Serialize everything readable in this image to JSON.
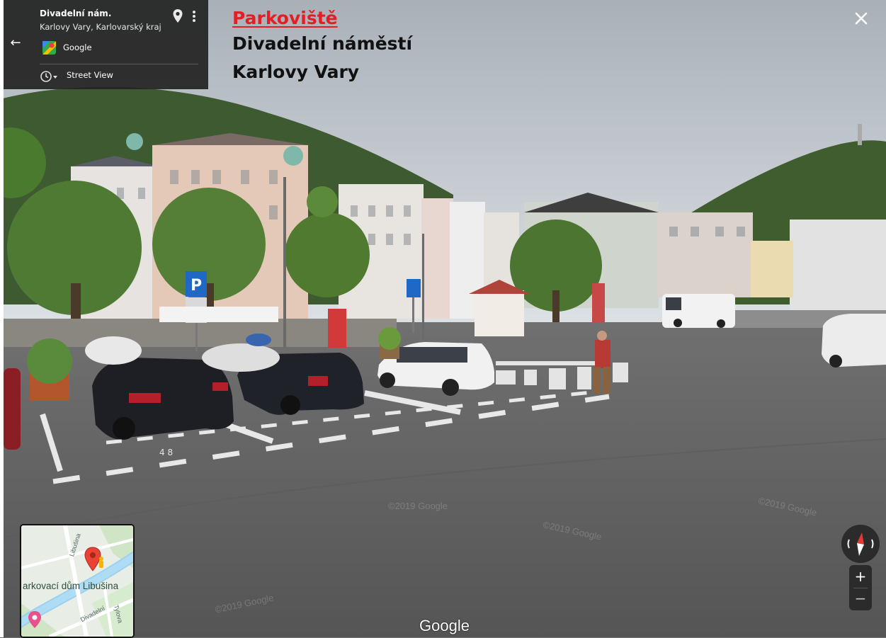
{
  "info_card": {
    "title": "Divadelní nám.",
    "subtitle": "Karlovy Vary, Karlovarský kraj",
    "provider_label": "Google",
    "mode_label": "Street View"
  },
  "overlay": {
    "label": "Parkoviště",
    "line1": "Divadelní náměstí",
    "line2": "Karlovy Vary"
  },
  "scene": {
    "sign_letter": "P",
    "parking_number": "4 8"
  },
  "minimap": {
    "place_label": "arkovací dům Libušina",
    "street_1": "Libušina",
    "street_2": "Divadelní",
    "street_3": "Tylova"
  },
  "controls": {
    "zoom_in_label": "+",
    "zoom_out_label": "−"
  },
  "watermark": {
    "logo_text": "Google",
    "copyright_1": "©2019 Google",
    "copyright_2": "©2019 Google",
    "copyright_3": "©2019 Google",
    "copyright_4": "©2019 Google"
  },
  "colors": {
    "overlay_label": "#e21f26",
    "card_bg": "#242424",
    "sky": "#c9d0d8",
    "road": "#5e5e5e",
    "map_pin": "#ea4335"
  }
}
